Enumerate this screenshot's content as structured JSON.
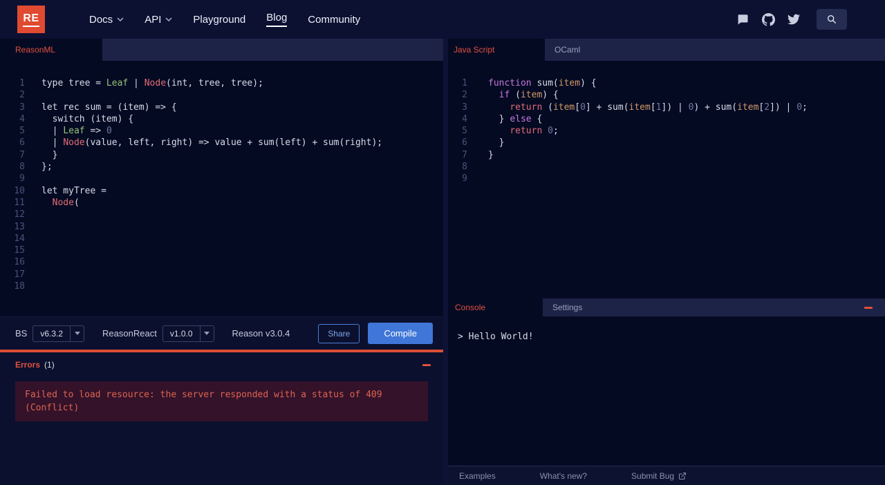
{
  "colors": {
    "accent_red": "#db4d3f",
    "tab_red": "#e0513e",
    "compile_blue": "#3f76d8",
    "share_blue": "#4a7fd6",
    "error_divider": "#dd4f37"
  },
  "navbar": {
    "logo_text": "RE",
    "items": [
      {
        "label": "Docs"
      },
      {
        "label": "API"
      },
      {
        "label": "Playground"
      },
      {
        "label": "Blog"
      },
      {
        "label": "Community"
      }
    ],
    "active_item": "Blog",
    "icons": [
      "discord-icon",
      "github-icon",
      "twitter-icon",
      "search-icon"
    ]
  },
  "reason_panel": {
    "tab_label": "ReasonML",
    "editor": {
      "total_lines": 18,
      "lines": [
        [
          [
            "p",
            "type tree = "
          ],
          [
            "g",
            "Leaf"
          ],
          [
            "p",
            " | "
          ],
          [
            "r",
            "Node"
          ],
          [
            "p",
            "(int, tree, tree);"
          ]
        ],
        [],
        [
          [
            "p",
            "let rec sum = (item) => {"
          ]
        ],
        [
          [
            "p",
            "  switch (item) {"
          ]
        ],
        [
          [
            "p",
            "  | "
          ],
          [
            "g",
            "Leaf"
          ],
          [
            "p",
            " => "
          ],
          [
            "n",
            "0"
          ]
        ],
        [
          [
            "p",
            "  | "
          ],
          [
            "r",
            "Node"
          ],
          [
            "p",
            "(value, left, right) => value + sum(left) + sum(right);"
          ]
        ],
        [
          [
            "p",
            "  }"
          ]
        ],
        [
          [
            "p",
            "};"
          ]
        ],
        [],
        [
          [
            "p",
            "let myTree ="
          ]
        ],
        [
          [
            "p",
            "  "
          ],
          [
            "r",
            "Node"
          ],
          [
            "p",
            "("
          ]
        ],
        [],
        [],
        [],
        [],
        [],
        [],
        []
      ]
    },
    "toolbar": {
      "bs_label": "BS",
      "bs_version": "v6.3.2",
      "reasonreact_label": "ReasonReact",
      "reasonreact_version": "v1.0.0",
      "reason_version": "Reason v3.0.4",
      "share_label": "Share",
      "compile_label": "Compile"
    },
    "errors": {
      "title": "Errors",
      "count": "(1)",
      "message": "Failed to load resource: the server responded with a status of 409 (Conflict)"
    }
  },
  "output_panel": {
    "tabs": [
      {
        "label": "Java Script"
      },
      {
        "label": "OCaml"
      }
    ],
    "active_tab": "Java Script",
    "editor": {
      "total_lines": 9,
      "lines": [
        [
          [
            "k",
            "function"
          ],
          [
            "p",
            " sum("
          ],
          [
            "o",
            "item"
          ],
          [
            "p",
            ") {"
          ]
        ],
        [
          [
            "p",
            "  "
          ],
          [
            "k",
            "if"
          ],
          [
            "p",
            " ("
          ],
          [
            "o",
            "item"
          ],
          [
            "p",
            ") {"
          ]
        ],
        [
          [
            "p",
            "    "
          ],
          [
            "r",
            "return"
          ],
          [
            "p",
            " ("
          ],
          [
            "o",
            "item"
          ],
          [
            "p",
            "["
          ],
          [
            "n",
            "0"
          ],
          [
            "p",
            "] + sum("
          ],
          [
            "o",
            "item"
          ],
          [
            "p",
            "["
          ],
          [
            "n",
            "1"
          ],
          [
            "p",
            "]) | "
          ],
          [
            "n",
            "0"
          ],
          [
            "p",
            ") + sum("
          ],
          [
            "o",
            "item"
          ],
          [
            "p",
            "["
          ],
          [
            "n",
            "2"
          ],
          [
            "p",
            "]) | "
          ],
          [
            "n",
            "0"
          ],
          [
            "p",
            ";"
          ]
        ],
        [
          [
            "p",
            "  } "
          ],
          [
            "k",
            "else"
          ],
          [
            "p",
            " {"
          ]
        ],
        [
          [
            "p",
            "    "
          ],
          [
            "r",
            "return"
          ],
          [
            "p",
            " "
          ],
          [
            "n",
            "0"
          ],
          [
            "p",
            ";"
          ]
        ],
        [
          [
            "p",
            "  }"
          ]
        ],
        [
          [
            "p",
            "}"
          ]
        ],
        [],
        []
      ]
    },
    "console": {
      "tabs": [
        {
          "label": "Console"
        },
        {
          "label": "Settings"
        }
      ],
      "active_tab": "Console",
      "output": "> Hello World!"
    },
    "footer": {
      "links": [
        {
          "label": "Examples"
        },
        {
          "label": "What's new?"
        },
        {
          "label": "Submit Bug"
        }
      ]
    }
  }
}
